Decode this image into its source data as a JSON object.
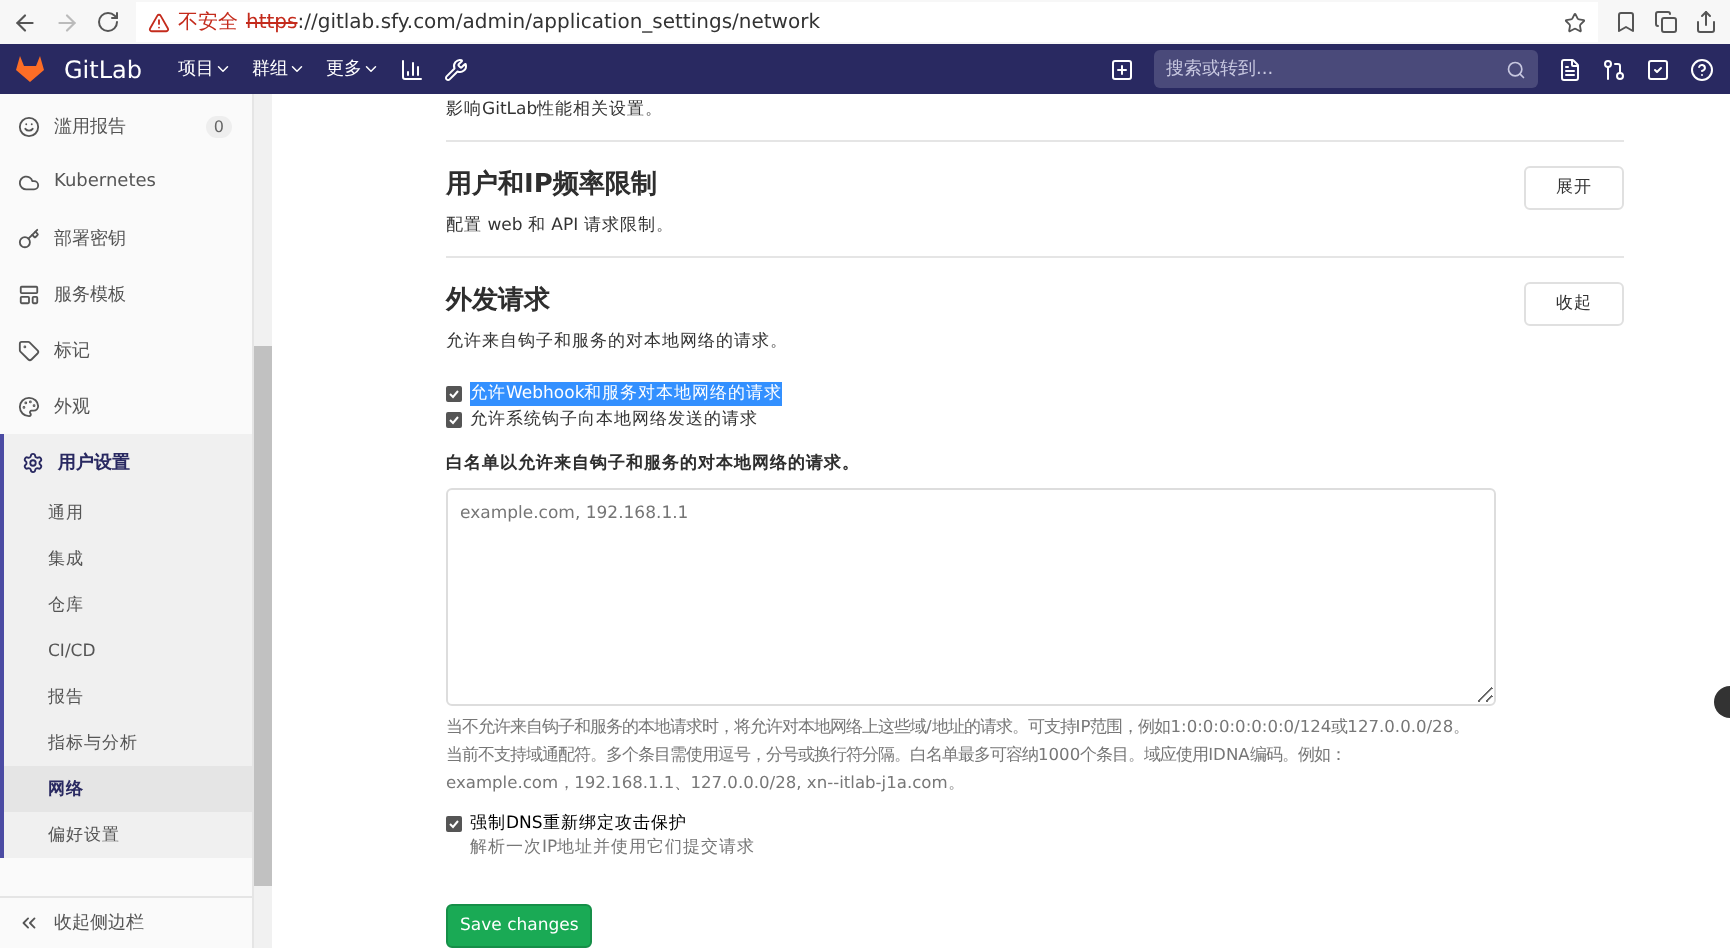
{
  "browser": {
    "security_label": "不安全",
    "url_scheme": "https",
    "url_rest": "://gitlab.sfy.com/admin/application_settings/network"
  },
  "navbar": {
    "brand": "GitLab",
    "menus": [
      {
        "label": "项目"
      },
      {
        "label": "群组"
      },
      {
        "label": "更多"
      }
    ],
    "search": {
      "placeholder": "搜索或转到..."
    }
  },
  "sidebar": {
    "items": [
      {
        "label": "滥用报告",
        "badge": "0",
        "expanded": false
      },
      {
        "label": "Kubernetes",
        "expanded": false
      },
      {
        "label": "部署密钥",
        "expanded": false
      },
      {
        "label": "服务模板",
        "expanded": false
      },
      {
        "label": "标记",
        "expanded": false
      },
      {
        "label": "外观",
        "expanded": false
      },
      {
        "label": "用户设置",
        "expanded": true,
        "children": [
          {
            "label": "通用",
            "selected": false
          },
          {
            "label": "集成",
            "selected": false
          },
          {
            "label": "仓库",
            "selected": false
          },
          {
            "label": "CI/CD",
            "selected": false
          },
          {
            "label": "报告",
            "selected": false
          },
          {
            "label": "指标与分析",
            "selected": false
          },
          {
            "label": "网络",
            "selected": true
          },
          {
            "label": "偏好设置",
            "selected": false
          }
        ]
      }
    ],
    "collapse_label": "收起侧边栏"
  },
  "content": {
    "top_text": "影响GitLab性能相关设置。",
    "sections": [
      {
        "title": "用户和IP频率限制",
        "description": "配置 web 和 API 请求限制。",
        "button": "展开"
      },
      {
        "title": "外发请求",
        "description": "允许来自钩子和服务的对本地网络的请求。",
        "button": "收起",
        "checkboxes": [
          {
            "label": "允许Webhook和服务对本地网络的请求",
            "checked": true,
            "selected": true
          },
          {
            "label": "允许系统钩子向本地网络发送的请求",
            "checked": true,
            "selected": false
          }
        ],
        "whitelist_label": "白名单以允许来自钩子和服务的对本地网络的请求。",
        "whitelist": {
          "placeholder": "example.com, 192.168.1.1"
        },
        "help_lines": [
          "当不允许来自钩子和服务的本地请求时，将允许对本地网络上这些域/地址的请求。可支持IP范围，例如1:0:0:0:0:0:0:0/124或127.0.0.0/28。",
          "当前不支持域通配符。多个条目需使用逗号，分号或换行符分隔。白名单最多可容纳1000个条目。域应使用IDNA编码。例如：",
          "example.com，192.168.1.1、127.0.0.0/28, xn--itlab-j1a.com。"
        ],
        "dns": {
          "label": "强制DNS重新绑定攻击保护",
          "hint": "解析一次IP地址并使用它们提交请求",
          "checked": true
        }
      }
    ],
    "save_button": "Save changes"
  }
}
